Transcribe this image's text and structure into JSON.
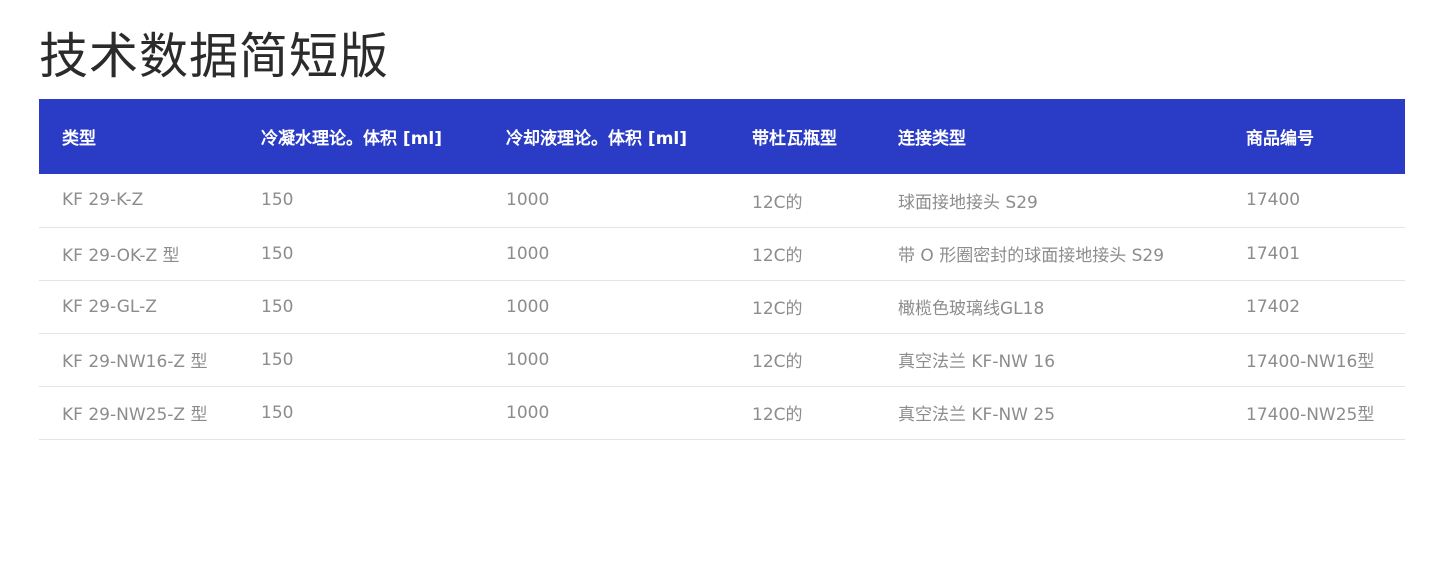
{
  "page": {
    "title": "技术数据简短版"
  },
  "table": {
    "headers": [
      "类型",
      "冷凝水理论。体积 [ml]",
      "冷却液理论。体积 [ml]",
      "带杜瓦瓶型",
      "连接类型",
      "商品编号"
    ],
    "rows": [
      [
        "KF 29-K-Z",
        "150",
        "1000",
        "12C的",
        "球面接地接头 S29",
        "17400"
      ],
      [
        "KF 29-OK-Z 型",
        "150",
        "1000",
        "12C的",
        "带 O 形圈密封的球面接地接头 S29",
        "17401"
      ],
      [
        "KF 29-GL-Z",
        "150",
        "1000",
        "12C的",
        "橄榄色玻璃线GL18",
        "17402"
      ],
      [
        "KF 29-NW16-Z 型",
        "150",
        "1000",
        "12C的",
        "真空法兰 KF-NW 16",
        "17400-NW16型"
      ],
      [
        "KF 29-NW25-Z 型",
        "150",
        "1000",
        "12C的",
        "真空法兰 KF-NW 25",
        "17400-NW25型"
      ]
    ]
  },
  "colors": {
    "header_background": "#2a3bc6",
    "header_text": "#ffffff",
    "title_text": "#2b2b2b",
    "cell_text": "#8c8c8c",
    "row_divider": "#e4e4e4"
  }
}
